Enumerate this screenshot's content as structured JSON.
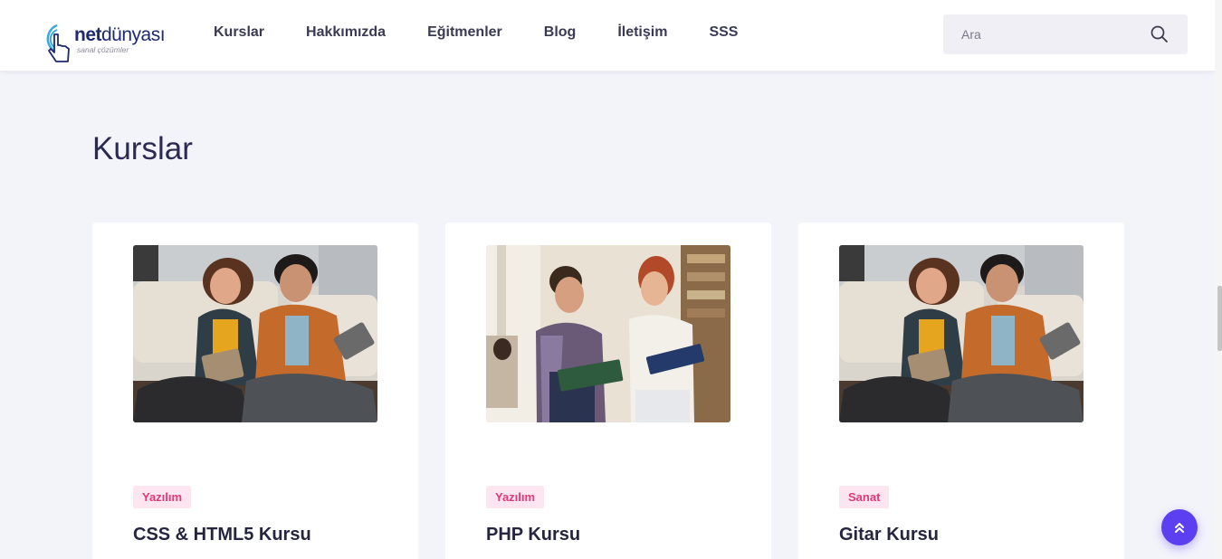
{
  "header": {
    "logo": {
      "brand_bold": "net",
      "brand_rest": "dünyası",
      "tagline": "sanal çözümler"
    },
    "nav": [
      {
        "label": "Kurslar"
      },
      {
        "label": "Hakkımızda"
      },
      {
        "label": "Eğitmenler"
      },
      {
        "label": "Blog"
      },
      {
        "label": "İletişim"
      },
      {
        "label": "SSS"
      }
    ],
    "search": {
      "placeholder": "Ara",
      "value": "",
      "icon": "search-icon"
    }
  },
  "main": {
    "title": "Kurslar",
    "courses": [
      {
        "category": "Yazılım",
        "title": "CSS & HTML5 Kursu",
        "image": "students-with-tablet-photo"
      },
      {
        "category": "Yazılım",
        "title": "PHP Kursu",
        "image": "students-with-books-photo"
      },
      {
        "category": "Sanat",
        "title": "Gitar Kursu",
        "image": "students-with-tablet-photo"
      }
    ]
  },
  "scroll_top": {
    "icon": "double-chevron-up-icon"
  },
  "colors": {
    "accent": "#5b3ff0",
    "tag_bg": "#fde6ef",
    "tag_text": "#e03a7a",
    "page_bg": "#f3f3fa",
    "heading": "#2a2a52"
  }
}
